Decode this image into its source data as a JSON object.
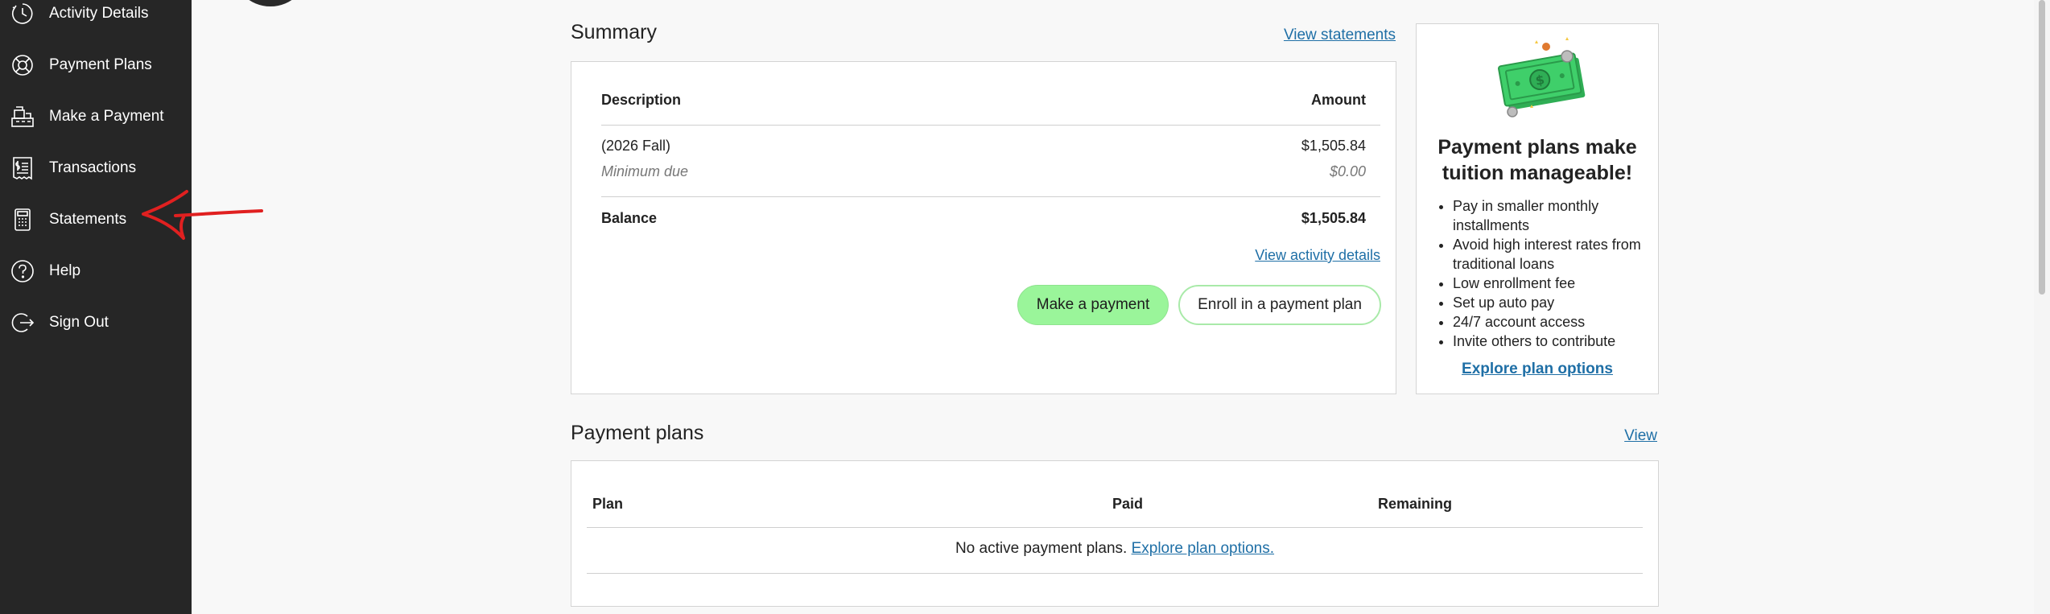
{
  "sidebar": {
    "items": [
      {
        "label": "Activity Details",
        "icon": "clock-icon"
      },
      {
        "label": "Payment Plans",
        "icon": "lifebuoy-icon"
      },
      {
        "label": "Make a Payment",
        "icon": "register-icon"
      },
      {
        "label": "Transactions",
        "icon": "receipt-icon"
      },
      {
        "label": "Statements",
        "icon": "calculator-icon"
      },
      {
        "label": "Help",
        "icon": "help-icon"
      },
      {
        "label": "Sign Out",
        "icon": "sign-out-icon"
      }
    ]
  },
  "summary": {
    "title": "Summary",
    "view_statements": "View statements",
    "table": {
      "col_description": "Description",
      "col_amount": "Amount",
      "term": "(2026 Fall)",
      "term_amount": "$1,505.84",
      "min_due_label": "Minimum due",
      "min_due_amount": "$0.00",
      "balance_label": "Balance",
      "balance_amount": "$1,505.84"
    },
    "view_activity": "View activity details",
    "make_payment": "Make a payment",
    "enroll": "Enroll in a payment plan"
  },
  "promo": {
    "title_line1": "Payment plans make",
    "title_line2": "tuition manageable!",
    "bullets": [
      "Pay in smaller monthly installments",
      "Avoid high interest rates from traditional loans",
      "Low enrollment fee",
      "Set up auto pay",
      "24/7 account access",
      "Invite others to contribute"
    ],
    "explore": "Explore plan options",
    "illustration": "money-bill-icon"
  },
  "payment_plans": {
    "title": "Payment plans",
    "view": "View",
    "col_plan": "Plan",
    "col_paid": "Paid",
    "col_remaining": "Remaining",
    "empty_text": "No active payment plans.",
    "empty_link": "Explore plan options."
  },
  "colors": {
    "sidebar_bg": "#262626",
    "link": "#1f6fa6",
    "primary_button": "#9af59a",
    "annotation": "#e02020"
  }
}
